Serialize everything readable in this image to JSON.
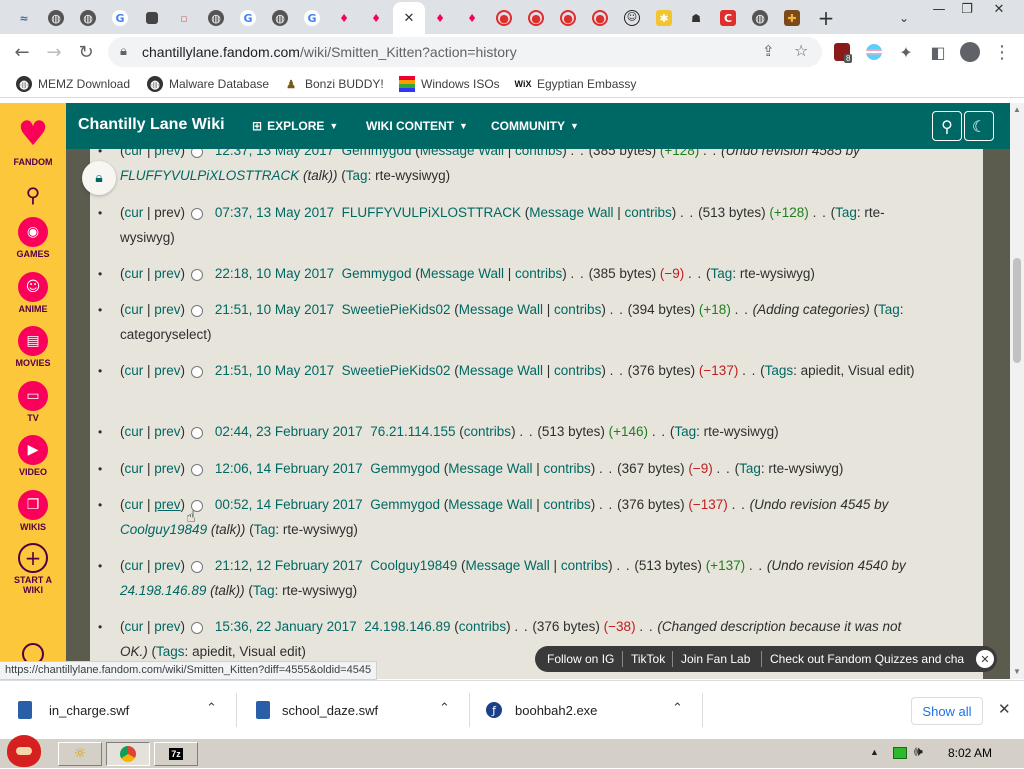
{
  "browser": {
    "url_main": "chantillylane.fandom.com",
    "url_rest": "/wiki/Smitten_Kitten?action=history",
    "extension_badge": "8",
    "bookmarks": [
      {
        "label": "MEMZ Download"
      },
      {
        "label": "Malware Database"
      },
      {
        "label": "Bonzi BUDDY!"
      },
      {
        "label": "Windows ISOs"
      },
      {
        "label": "Egyptian Embassy"
      }
    ]
  },
  "rail": {
    "logo_label": "FANDOM",
    "items": [
      {
        "label": "GAMES"
      },
      {
        "label": "ANIME"
      },
      {
        "label": "MOVIES"
      },
      {
        "label": "TV"
      },
      {
        "label": "VIDEO"
      },
      {
        "label": "WIKIS"
      },
      {
        "label": "START A WIKI"
      }
    ]
  },
  "wiki": {
    "title": "Chantilly Lane Wiki",
    "nav": [
      "EXPLORE",
      "WIKI CONTENT",
      "COMMUNITY"
    ]
  },
  "history": {
    "cur": "cur",
    "prev": "prev",
    "message_wall": "Message Wall",
    "contribs": "contribs",
    "talk": "talk",
    "tag": "Tag",
    "tags": "Tags",
    "rows": [
      {
        "time": "12:37, 13 May 2017",
        "user": "Gemmygod",
        "size": "(385 bytes)",
        "diff": "(+128)",
        "summary_pre": "(Undo revision 4585 by ",
        "summary_link": "FLUFFYVULPiXLOSTTRACK",
        "summary_post": " (talk))",
        "tag": "rte-wysiwyg"
      },
      {
        "time": "07:37, 13 May 2017",
        "user": "FLUFFYVULPiXLOSTTRACK",
        "size": "(513 bytes)",
        "diff": "(+128)",
        "tag": "rte-wysiwyg"
      },
      {
        "time": "22:18, 10 May 2017",
        "user": "Gemmygod",
        "size": "(385 bytes)",
        "diff": "(−9)",
        "tag": "rte-wysiwyg"
      },
      {
        "time": "21:51, 10 May 2017",
        "user": "SweetiePieKids02",
        "size": "(394 bytes)",
        "diff": "(+18)",
        "summary": "(Adding categories)",
        "tag": "categoryselect"
      },
      {
        "time": "21:51, 10 May 2017",
        "user": "SweetiePieKids02",
        "size": "(376 bytes)",
        "diff": "(−137)",
        "tags": "apiedit, Visual edit"
      },
      {
        "time": "02:44, 23 February 2017",
        "user": "76.21.114.155",
        "size": "(513 bytes)",
        "diff": "(+146)",
        "tag": "rte-wysiwyg"
      },
      {
        "time": "12:06, 14 February 2017",
        "user": "Gemmygod",
        "size": "(367 bytes)",
        "diff": "(−9)",
        "tag": "rte-wysiwyg"
      },
      {
        "time": "00:52, 14 February 2017",
        "user": "Gemmygod",
        "size": "(376 bytes)",
        "diff": "(−137)",
        "summary_pre": "(Undo revision 4545 by ",
        "summary_link": "Coolguy19849",
        "summary_post": " (talk))",
        "tag": "rte-wysiwyg"
      },
      {
        "time": "21:12, 12 February 2017",
        "user": "Coolguy19849",
        "size": "(513 bytes)",
        "diff": "(+137)",
        "summary_pre": "(Undo revision 4540 by ",
        "summary_link": "24.198.146.89",
        "summary_post": " (talk))",
        "tag": "rte-wysiwyg"
      },
      {
        "time": "15:36, 22 January 2017",
        "user": "24.198.146.89",
        "size": "(376 bytes)",
        "diff": "(−38)",
        "summary": "(Changed description because it was not OK.)",
        "tags": "apiedit, Visual edit"
      }
    ]
  },
  "fanbar": {
    "items": [
      "Follow on IG",
      "TikTok",
      "Join Fan Lab",
      "Check out Fandom Quizzes and cha"
    ]
  },
  "status_url": "https://chantillylane.fandom.com/wiki/Smitten_Kitten?diff=4555&oldid=4545",
  "downloads": {
    "items": [
      {
        "name": "in_charge.swf"
      },
      {
        "name": "school_daze.swf"
      },
      {
        "name": "boohbah2.exe"
      }
    ],
    "show_all": "Show all"
  },
  "taskbar": {
    "clock": "8:02 AM"
  },
  "colors": {
    "wiki_header": "#006864",
    "rail": "#fcc73a",
    "link": "#006864",
    "positive": "#1d7f1d",
    "negative": "#c11d1d"
  }
}
